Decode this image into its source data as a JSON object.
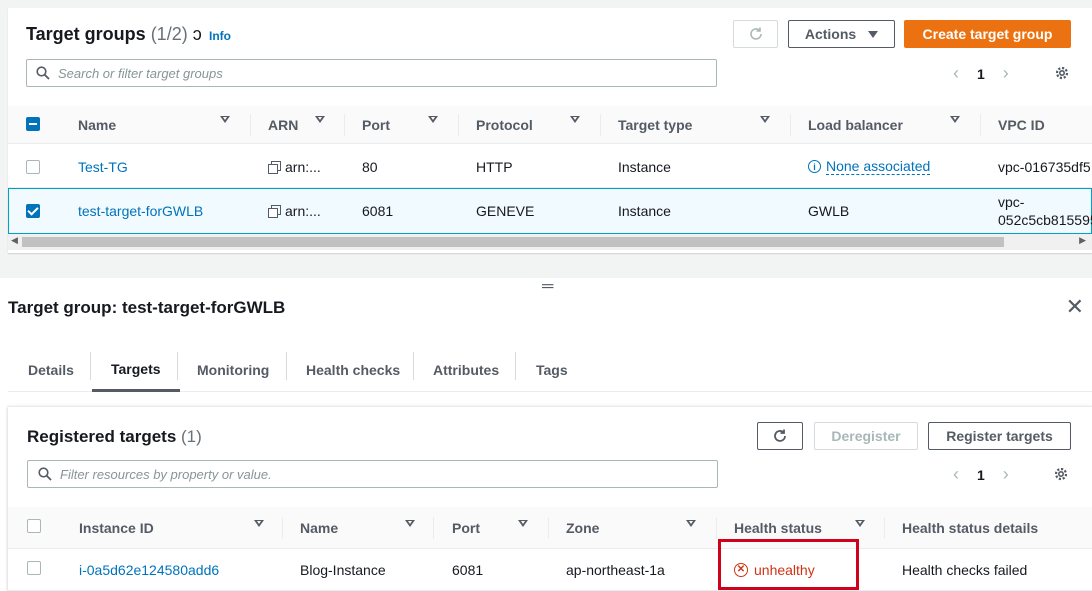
{
  "target_groups": {
    "title": "Target groups",
    "count": "(1/2)",
    "info_label": "Info",
    "actions_label": "Actions",
    "create_label": "Create target group",
    "search_placeholder": "Search or filter target groups",
    "page": "1",
    "columns": [
      "Name",
      "ARN",
      "Port",
      "Protocol",
      "Target type",
      "Load balancer",
      "VPC ID"
    ],
    "rows": [
      {
        "name": "Test-TG",
        "arn": "arn:...",
        "port": "80",
        "protocol": "HTTP",
        "target_type": "Instance",
        "load_balancer": "None associated",
        "vpc": "vpc-016735df5",
        "selected": false
      },
      {
        "name": "test-target-forGWLB",
        "arn": "arn:...",
        "port": "6081",
        "protocol": "GENEVE",
        "target_type": "Instance",
        "load_balancer": "GWLB",
        "vpc_line1": "vpc-",
        "vpc_line2": "052c5cb815595",
        "selected": true
      }
    ]
  },
  "detail": {
    "title": "Target group: test-target-forGWLB",
    "tabs": [
      "Details",
      "Targets",
      "Monitoring",
      "Health checks",
      "Attributes",
      "Tags"
    ],
    "active_tab": "Targets"
  },
  "registered": {
    "title": "Registered targets",
    "count": "(1)",
    "deregister_label": "Deregister",
    "register_label": "Register targets",
    "filter_placeholder": "Filter resources by property or value.",
    "page": "1",
    "columns": [
      "Instance ID",
      "Name",
      "Port",
      "Zone",
      "Health status",
      "Health status details"
    ],
    "rows": [
      {
        "instance_id": "i-0a5d62e124580add6",
        "name": "Blog-Instance",
        "port": "6081",
        "zone": "ap-northeast-1a",
        "health": "unhealthy",
        "health_details": "Health checks failed"
      }
    ]
  },
  "colors": {
    "link": "#0073bb",
    "primary": "#ec7211",
    "error": "#d13212",
    "highlight_box": "#d0021b"
  }
}
